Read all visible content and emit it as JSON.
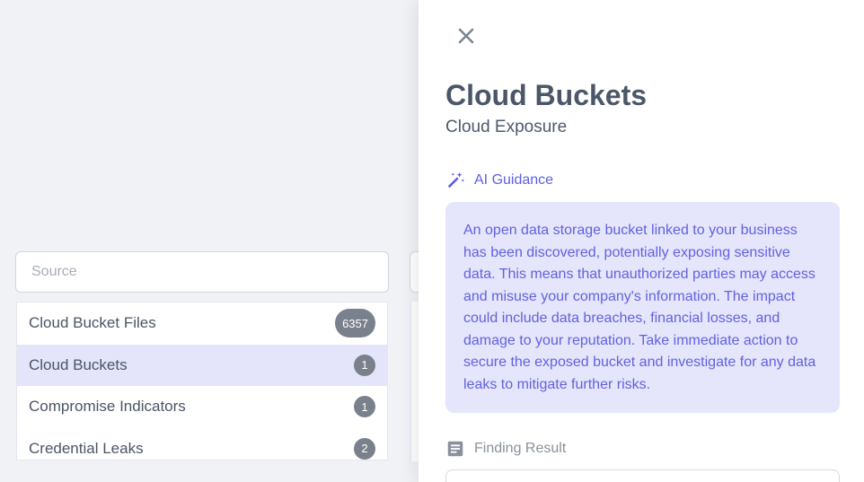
{
  "source_filter": {
    "placeholder": "Source",
    "value": ""
  },
  "source_list": [
    {
      "label": "Cloud Bucket Files",
      "count": "6357",
      "active": false
    },
    {
      "label": "Cloud Buckets",
      "count": "1",
      "active": true
    },
    {
      "label": "Compromise Indicators",
      "count": "1",
      "active": false
    },
    {
      "label": "Credential Leaks",
      "count": "2",
      "active": false
    }
  ],
  "drawer": {
    "close_icon": "close-icon",
    "title": "Cloud Buckets",
    "subtitle": "Cloud Exposure",
    "ai_guidance": {
      "icon": "magic-wand-icon",
      "title": "AI Guidance",
      "text": "An open data storage bucket linked to your business has been discovered, potentially exposing sensitive data. This means that unauthorized parties may access and misuse your company's information. The impact could include data breaches, financial losses, and damage to your reputation. Take immediate action to secure the exposed bucket and investigate for any data leaks to mitigate further risks."
    },
    "finding_result": {
      "icon": "notes-icon",
      "title": "Finding Result"
    }
  },
  "colors": {
    "accent": "#5d5fe0",
    "accent_bg": "#e5e5fb",
    "badge": "#7a818d",
    "text_dark": "#4b5768"
  }
}
